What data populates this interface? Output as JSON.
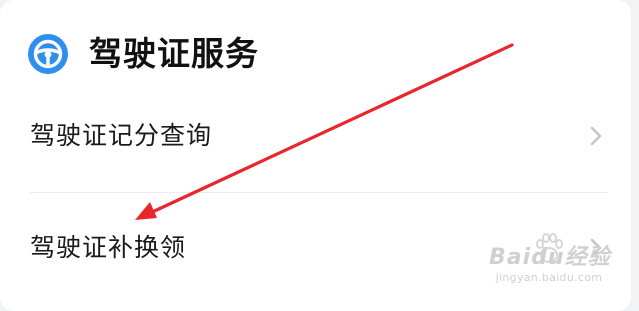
{
  "section": {
    "title": "驾驶证服务",
    "icon": "steering-wheel-icon",
    "accent": "#2f8ff0"
  },
  "items": [
    {
      "label": "驾驶证记分查询",
      "icon": "chevron-right-icon"
    },
    {
      "label": "驾驶证补换领",
      "icon": "chevron-right-icon"
    }
  ],
  "annotation": {
    "color": "#e8262c",
    "icon": "arrow-pointer-icon"
  },
  "watermark": {
    "logo": "Baidu经验",
    "url": "jingyan.baidu.com"
  }
}
